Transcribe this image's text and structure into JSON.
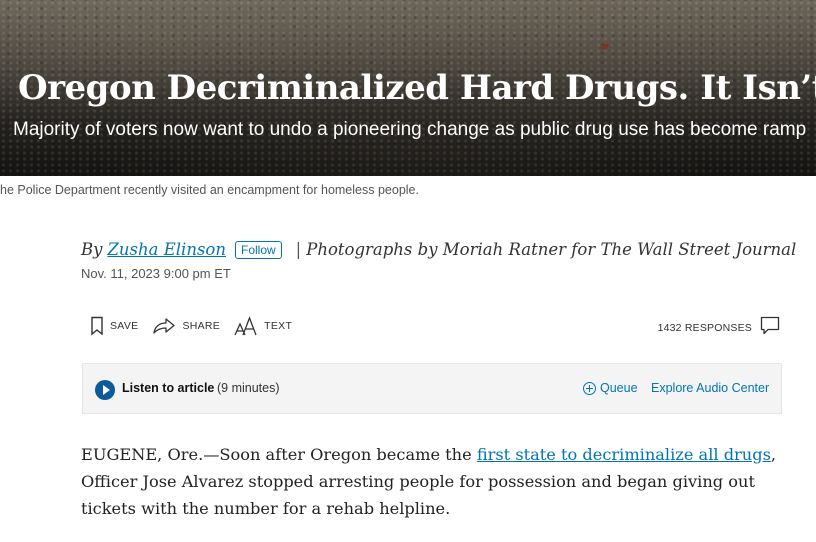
{
  "article": {
    "headline": "Oregon Decriminalized Hard Drugs. It Isn’t Working",
    "dek": "Majority of voters now want to undo a pioneering change as public drug use has become ramp",
    "photo_caption": "he Police Department recently visited an encampment for homeless people.",
    "byline": {
      "by_prefix": "By",
      "author": "Zusha Elinson",
      "follow_label": "Follow",
      "separator": "|",
      "photo_credit": "Photographs by Moriah Ratner for The Wall Street Journal"
    },
    "date": "Nov. 11, 2023 9:00 pm ET"
  },
  "toolbar": {
    "save_label": "SAVE",
    "share_label": "SHARE",
    "text_label": "TEXT",
    "responses_label": "1432 RESPONSES",
    "icons": [
      "bookmark-icon",
      "share-icon",
      "text-size-icon",
      "comment-icon"
    ]
  },
  "audio": {
    "listen_label": "Listen to article",
    "duration": "(9 minutes)",
    "queue_label": "Queue",
    "explore_label": "Explore Audio Center"
  },
  "body": {
    "p1_before": "EUGENE, Ore.—Soon after Oregon became the ",
    "p1_link": "first state to decriminalize all drugs",
    "p1_after": ", Officer Jose Alvarez stopped arresting people for possession and began giving out tickets with the number for a rehab helpline."
  },
  "colors": {
    "link": "#0274b6",
    "play_button": "#0a5a9c",
    "audio_bar_bg": "#f4f4f4"
  }
}
